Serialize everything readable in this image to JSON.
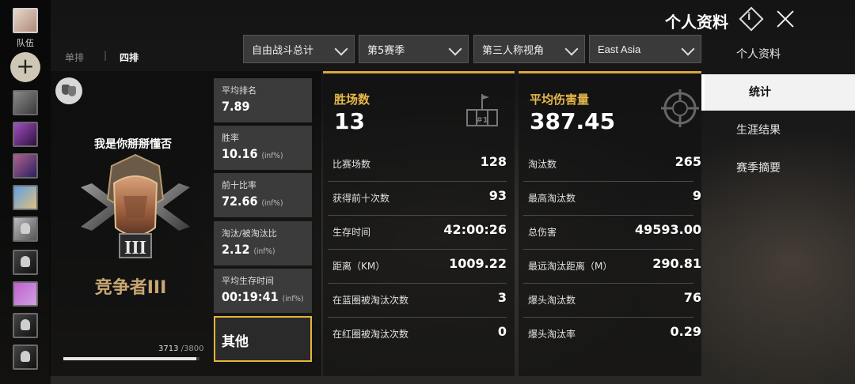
{
  "left_column": {
    "team_label": "队伍",
    "add_button": "+"
  },
  "header": {
    "title": "个人资料",
    "info_icon_glyph": "i"
  },
  "mode_tabs": {
    "solo": "单排",
    "separator": "|",
    "squad": "四排",
    "selected": "四排"
  },
  "filters": {
    "mode": "自由战斗总计",
    "season": "第5赛季",
    "perspective": "第三人称视角",
    "region": "East Asia"
  },
  "nav": {
    "items": [
      {
        "label": "个人资料",
        "active": false
      },
      {
        "label": "统计",
        "active": true
      },
      {
        "label": "生涯结果",
        "active": false
      },
      {
        "label": "赛季摘要",
        "active": false
      }
    ]
  },
  "player": {
    "name": "我是你掰掰懂否",
    "tier_name": "竞争者III",
    "tier_numeral": "III",
    "points": "3713",
    "points_max": "/3800",
    "progress_fraction": 0.977
  },
  "mini_stats": [
    {
      "label": "平均排名",
      "value": "7.89",
      "suffix": ""
    },
    {
      "label": "胜率",
      "value": "10.16",
      "suffix": "(inf%)"
    },
    {
      "label": "前十比率",
      "value": "72.66",
      "suffix": "(inf%)"
    },
    {
      "label": "淘汰/被淘汰比",
      "value": "2.12",
      "suffix": "(inf%)"
    },
    {
      "label": "平均生存时间",
      "value": "00:19:41",
      "suffix": "(inf%)"
    }
  ],
  "other_button": "其他",
  "wins_panel": {
    "title": "胜场数",
    "value": "13",
    "trophy_text": "#1",
    "rows": [
      {
        "label": "比赛场数",
        "value": "128"
      },
      {
        "label": "获得前十次数",
        "value": "93"
      },
      {
        "label": "生存时间",
        "value": "42:00:26"
      },
      {
        "label": "距离（KM）",
        "value": "1009.22"
      },
      {
        "label": "在蓝圈被淘汰次数",
        "value": "3"
      },
      {
        "label": "在红圈被淘汰次数",
        "value": "0"
      }
    ]
  },
  "damage_panel": {
    "title": "平均伤害量",
    "value": "387.45",
    "rows": [
      {
        "label": "淘汰数",
        "value": "265"
      },
      {
        "label": "最高淘汰数",
        "value": "9"
      },
      {
        "label": "总伤害",
        "value": "49593.00"
      },
      {
        "label": "最远淘汰距离（M）",
        "value": "290.81"
      },
      {
        "label": "爆头淘汰数",
        "value": "76"
      },
      {
        "label": "爆头淘汰率",
        "value": "0.29"
      }
    ]
  },
  "colors": {
    "accent_gold": "#d9a63a",
    "tier_text": "#c9a774",
    "panel_bg": "#121212"
  }
}
